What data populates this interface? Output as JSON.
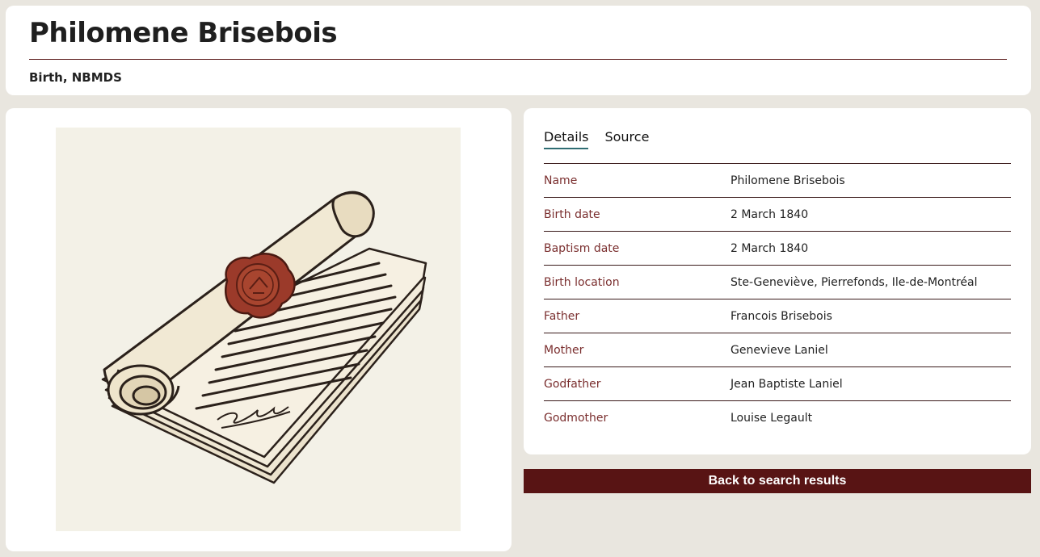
{
  "header": {
    "title": "Philomene Brisebois",
    "subtitle": "Birth, NBMDS"
  },
  "image": {
    "icon": "scroll-with-wax-seal-illustration",
    "background": "#f3f1e7",
    "seal_color": "#9b3a2a"
  },
  "tabs": [
    {
      "label": "Details",
      "active": true
    },
    {
      "label": "Source",
      "active": false
    }
  ],
  "details": [
    {
      "label": "Name",
      "value": "Philomene Brisebois"
    },
    {
      "label": "Birth date",
      "value": "2 March 1840"
    },
    {
      "label": "Baptism date",
      "value": "2 March 1840"
    },
    {
      "label": "Birth location",
      "value": "Ste-Geneviève, Pierrefonds, Ile-de-Montréal"
    },
    {
      "label": "Father",
      "value": "Francois Brisebois"
    },
    {
      "label": "Mother",
      "value": "Genevieve Laniel"
    },
    {
      "label": "Godfather",
      "value": "Jean Baptiste Laniel"
    },
    {
      "label": "Godmother",
      "value": "Louise Legault"
    }
  ],
  "back_button": {
    "label": "Back to search results"
  },
  "colors": {
    "accent": "#581414",
    "label_text": "#7a2e2e",
    "tab_underline": "#2f6d73",
    "page_background": "#e9e6df"
  }
}
